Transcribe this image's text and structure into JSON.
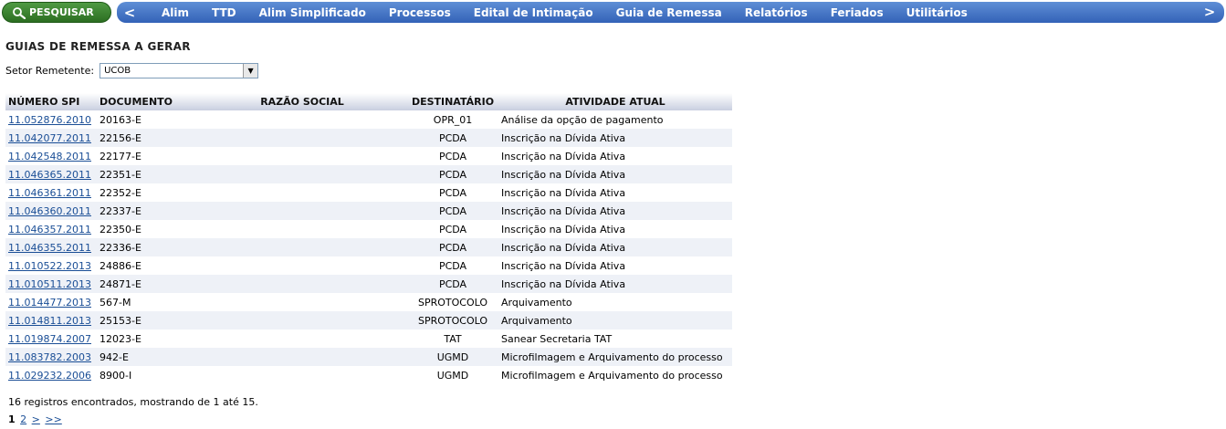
{
  "toolbar": {
    "search_label": "PESQUISAR"
  },
  "nav": {
    "left_arrow": "<",
    "right_arrow": ">",
    "items": [
      "Alim",
      "TTD",
      "Alim Simplificado",
      "Processos",
      "Edital de Intimação",
      "Guia de Remessa",
      "Relatórios",
      "Feriados",
      "Utilitários"
    ]
  },
  "page": {
    "title": "GUIAS DE REMESSA A GERAR",
    "sector_label": "Setor Remetente:",
    "sector_value": "UCOB"
  },
  "table": {
    "headers": [
      "NÚMERO SPI",
      "DOCUMENTO",
      "RAZÃO SOCIAL",
      "DESTINATÁRIO",
      "ATIVIDADE ATUAL"
    ],
    "rows": [
      [
        "11.052876.2010",
        "20163-E",
        "",
        "OPR_01",
        "Análise da opção de pagamento"
      ],
      [
        "11.042077.2011",
        "22156-E",
        "",
        "PCDA",
        "Inscrição na Dívida Ativa"
      ],
      [
        "11.042548.2011",
        "22177-E",
        "",
        "PCDA",
        "Inscrição na Dívida Ativa"
      ],
      [
        "11.046365.2011",
        "22351-E",
        "",
        "PCDA",
        "Inscrição na Dívida Ativa"
      ],
      [
        "11.046361.2011",
        "22352-E",
        "",
        "PCDA",
        "Inscrição na Dívida Ativa"
      ],
      [
        "11.046360.2011",
        "22337-E",
        "",
        "PCDA",
        "Inscrição na Dívida Ativa"
      ],
      [
        "11.046357.2011",
        "22350-E",
        "",
        "PCDA",
        "Inscrição na Dívida Ativa"
      ],
      [
        "11.046355.2011",
        "22336-E",
        "",
        "PCDA",
        "Inscrição na Dívida Ativa"
      ],
      [
        "11.010522.2013",
        "24886-E",
        "",
        "PCDA",
        "Inscrição na Dívida Ativa"
      ],
      [
        "11.010511.2013",
        "24871-E",
        "",
        "PCDA",
        "Inscrição na Dívida Ativa"
      ],
      [
        "11.014477.2013",
        "567-M",
        "",
        "SPROTOCOLO",
        "Arquivamento"
      ],
      [
        "11.014811.2013",
        "25153-E",
        "",
        "SPROTOCOLO",
        "Arquivamento"
      ],
      [
        "11.019874.2007",
        "12023-E",
        "",
        "TAT",
        "Sanear Secretaria TAT"
      ],
      [
        "11.083782.2003",
        "942-E",
        "",
        "UGMD",
        "Microfilmagem e Arquivamento do processo"
      ],
      [
        "11.029232.2006",
        "8900-I",
        "",
        "UGMD",
        "Microfilmagem e Arquivamento do processo"
      ]
    ]
  },
  "footer": {
    "summary": "16 registros encontrados, mostrando de 1 até 15.",
    "pages": {
      "current": "1",
      "page2": "2",
      "next": ">",
      "last": ">>"
    }
  }
}
